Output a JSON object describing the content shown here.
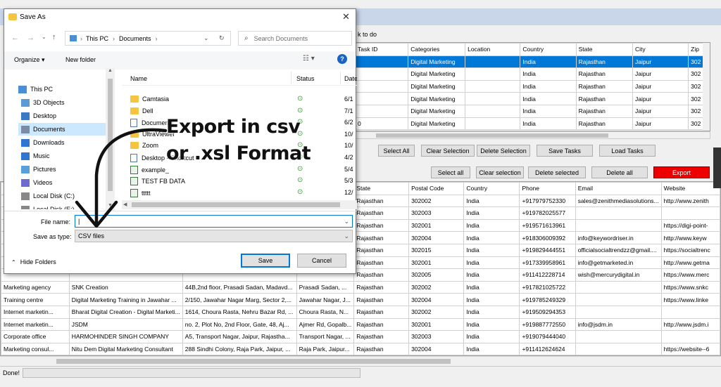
{
  "dialog": {
    "title": "Save As",
    "breadcrumb": [
      "This PC",
      "Documents"
    ],
    "search_placeholder": "Search Documents",
    "organize_label": "Organize ▾",
    "new_folder_label": "New folder",
    "nav_items": [
      "This PC",
      "3D Objects",
      "Desktop",
      "Documents",
      "Downloads",
      "Music",
      "Pictures",
      "Videos",
      "Local Disk (C:)",
      "Local Disk (E:)"
    ],
    "columns": {
      "name": "Name",
      "status": "Status",
      "date": "Date"
    },
    "files": [
      {
        "name": "Camtasia",
        "type": "folder",
        "date": "6/1"
      },
      {
        "name": "Dell",
        "type": "folder",
        "date": "7/1"
      },
      {
        "name": "Documents",
        "type": "doc",
        "date": "6/2"
      },
      {
        "name": "UltraViewer",
        "type": "folder",
        "date": "10/"
      },
      {
        "name": "Zoom",
        "type": "folder",
        "date": "10/"
      },
      {
        "name": "Desktop - Shortcut",
        "type": "shortcut",
        "date": "4/2"
      },
      {
        "name": "example_",
        "type": "xls",
        "date": "5/4"
      },
      {
        "name": "TEST FB DATA",
        "type": "xls",
        "date": "5/3"
      },
      {
        "name": "ttttt",
        "type": "xls",
        "date": "12/"
      }
    ],
    "file_name_label": "File name:",
    "file_name_value": "|",
    "save_type_label": "Save as type:",
    "save_type_value": "CSV files",
    "hide_folders_label": "Hide Folders",
    "save_label": "Save",
    "cancel_label": "Cancel"
  },
  "annotation": {
    "line1": "Export in csv",
    "line2": "or .xsl Format"
  },
  "app": {
    "task_label": "k to do",
    "top_grid": {
      "headers": [
        "Task ID",
        "Categories",
        "Location",
        "Country",
        "State",
        "City",
        "Zip"
      ],
      "rows": [
        [
          "",
          "Digital Marketing",
          "",
          "India",
          "Rajasthan",
          "Jaipur",
          "302"
        ],
        [
          "",
          "Digital Marketing",
          "",
          "India",
          "Rajasthan",
          "Jaipur",
          "302"
        ],
        [
          "",
          "Digital Marketing",
          "",
          "India",
          "Rajasthan",
          "Jaipur",
          "302"
        ],
        [
          "",
          "Digital Marketing",
          "",
          "India",
          "Rajasthan",
          "Jaipur",
          "302"
        ],
        [
          "",
          "Digital Marketing",
          "",
          "India",
          "Rajasthan",
          "Jaipur",
          "302"
        ],
        [
          "0",
          "Digital Marketing",
          "",
          "India",
          "Rajasthan",
          "Jaipur",
          "302"
        ]
      ]
    },
    "task_buttons": [
      "Select All",
      "Clear Selection",
      "Delete Selection",
      "Save Tasks",
      "Load Tasks"
    ],
    "result_buttons": [
      "Select all",
      "Clear selection",
      "Delete selected",
      "Delete all",
      "Export"
    ],
    "bottom_grid": {
      "headers": [
        "",
        "",
        "",
        "",
        "State",
        "Postal Code",
        "Country",
        "Phone",
        "Email",
        "Website"
      ],
      "rows": [
        [
          "",
          "",
          "",
          "",
          "Rajasthan",
          "302002",
          "India",
          "+917979752330",
          "sales@zenithmediasolutions...",
          "http://www.zenith"
        ],
        [
          "",
          "",
          "",
          "",
          "Rajasthan",
          "302003",
          "India",
          "+919782025577",
          "",
          ""
        ],
        [
          "",
          "",
          "",
          "",
          "Rajasthan",
          "302001",
          "India",
          "+919571613961",
          "",
          "https://digi-point-"
        ],
        [
          "",
          "",
          "",
          "",
          "Rajasthan",
          "302004",
          "India",
          "+918306009392",
          "info@keywordriser.in",
          "http://www.keyw"
        ],
        [
          "",
          "",
          "",
          "",
          "Rajasthan",
          "302015",
          "India",
          "+919829444551",
          "officialsocialtrendzz@gmail....",
          "https://socialtrenc"
        ],
        [
          "",
          "",
          "",
          "",
          "Rajasthan",
          "302001",
          "India",
          "+917339958961",
          "info@getmarketed.in",
          "http://www.getma"
        ],
        [
          "",
          "",
          "",
          "",
          "Rajasthan",
          "302005",
          "India",
          "+911412228714",
          "wish@mercurydigital.in",
          "https://www.merc"
        ],
        [
          "Marketing agency",
          "SNK Creation",
          "44B,2nd floor, Prasadi Sadan, Madavd...",
          "Prasadi Sadan, ...",
          "Rajasthan",
          "302002",
          "India",
          "+917821025722",
          "",
          "https://www.snkc"
        ],
        [
          "Training centre",
          "Digital Marketing Training in Jawahar ...",
          "2/150, Jawahar Nagar Marg, Sector 2,...",
          "Jawahar Nagar, J...",
          "Rajasthan",
          "302004",
          "India",
          "+919785249329",
          "",
          "https://www.linke"
        ],
        [
          "Internet marketin...",
          "Bharat Digital Creation - Digital Marketi...",
          "1614, Choura Rasta, Nehru Bazar Rd, ...",
          "Choura Rasta, N...",
          "Rajasthan",
          "302002",
          "India",
          "+919509294353",
          "",
          ""
        ],
        [
          "Internet marketin...",
          "JSDM",
          "no. 2, Plot No, 2nd Floor, Gate, 48, Aj...",
          "Ajmer Rd, Gopalb...",
          "Rajasthan",
          "302001",
          "India",
          "+919887772550",
          "info@jsdm.in",
          "http://www.jsdm.i"
        ],
        [
          "Corporate office",
          "HARMOHINDER SINGH  COMPANY",
          "A5, Transport Nagar, Jaipur, Rajastha...",
          "Transport Nagar, ...",
          "Rajasthan",
          "302003",
          "India",
          "+919079444040",
          "",
          ""
        ],
        [
          "Marketing consul...",
          "Nitu Dem Digital Marketing Consultant",
          "288 Sindhi Colony, Raja Park, Jaipur, ...",
          "Raja Park, Jaipur...",
          "Rajasthan",
          "302004",
          "India",
          "+911412624624",
          "",
          "https://website--6"
        ]
      ]
    },
    "status_text": "Done!"
  },
  "colors": {
    "accent": "#0078d7",
    "export": "#ee0000",
    "check": "#2a9d2a"
  }
}
